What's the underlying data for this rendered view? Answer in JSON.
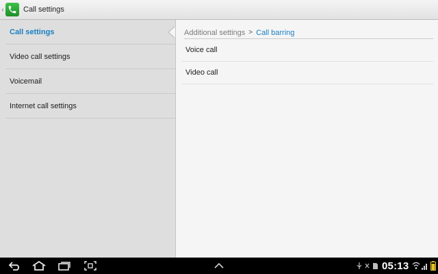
{
  "header": {
    "title": "Call settings",
    "app_icon": "phone-icon",
    "accent": "#2aa63a"
  },
  "sidebar": {
    "selected_color": "#1a7fc2",
    "items": [
      {
        "label": "Call settings",
        "selected": true
      },
      {
        "label": "Video call settings",
        "selected": false
      },
      {
        "label": "Voicemail",
        "selected": false
      },
      {
        "label": "Internet call settings",
        "selected": false
      }
    ]
  },
  "breadcrumb": {
    "parent": "Additional settings",
    "separator": ">",
    "current": "Call barring"
  },
  "list": {
    "items": [
      {
        "label": "Voice call"
      },
      {
        "label": "Video call"
      }
    ]
  },
  "system_bar": {
    "time": "05:13",
    "buttons": [
      "back-icon",
      "home-icon",
      "recent-apps-icon",
      "screenshot-icon",
      "up-arrow-icon"
    ],
    "status_icons": [
      "usb-icon",
      "usb-debug-icon",
      "sd-card-icon",
      "wifi-icon",
      "signal-icon",
      "battery-icon"
    ]
  }
}
